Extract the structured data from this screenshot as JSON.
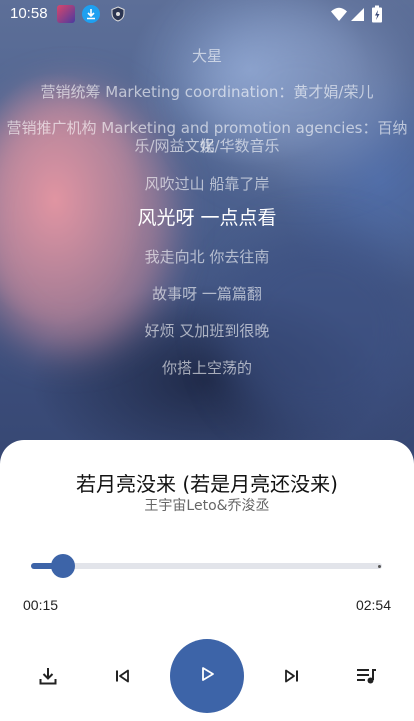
{
  "status_bar": {
    "time": "10:58",
    "icons": [
      "album-thumbnail-icon",
      "download-badge-icon",
      "shield-icon",
      "wifi-icon",
      "signal-icon",
      "battery-icon"
    ]
  },
  "lyrics": [
    "大星",
    "营销统筹 Marketing coordination：黄才娟/荣儿",
    "营销推广机构 Marketing and promotion agencies：百纳娱",
    "乐/网益文化/华数音乐",
    "风吹过山 船靠了岸",
    "风光呀 一点点看",
    "我走向北 你去往南",
    "故事呀 一篇篇翻",
    "好烦 又加班到很晚",
    "你搭上空荡的"
  ],
  "active_lyric_index": 5,
  "player": {
    "title": "若月亮没来 (若是月亮还没来)",
    "artist": "王宇宙Leto&乔浚丞",
    "current_time": "00:15",
    "total_time": "02:54",
    "progress_fraction": 0.09
  },
  "controls": {
    "download_icon": "download-icon",
    "previous_icon": "skip-previous-icon",
    "play_icon": "play-icon",
    "next_icon": "skip-next-icon",
    "queue_icon": "queue-music-icon"
  },
  "colors": {
    "accent": "#3d64a8",
    "panel_bg": "#ffffff",
    "track_bg": "#e2e4ea"
  }
}
